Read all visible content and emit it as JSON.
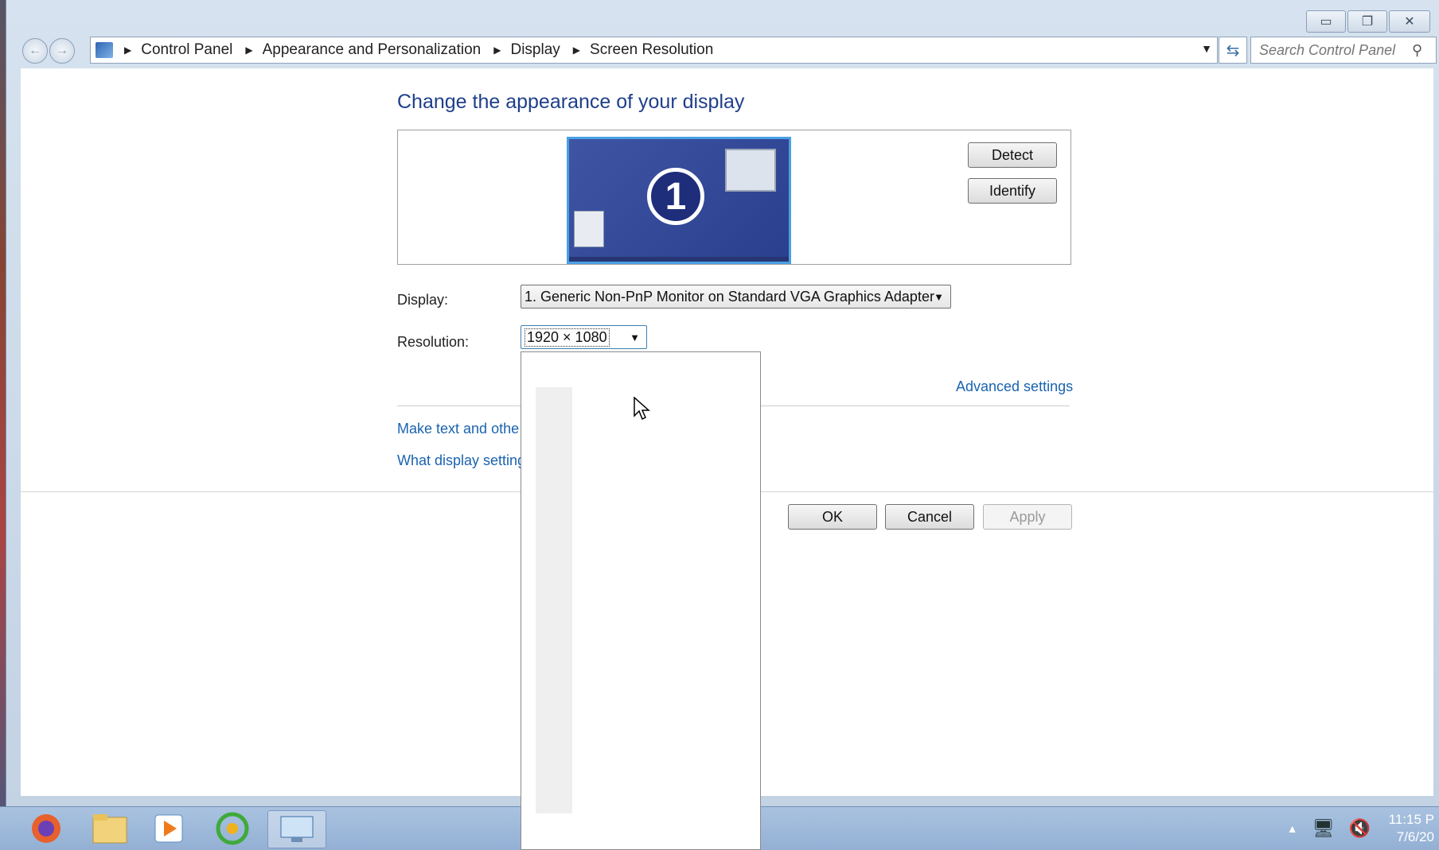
{
  "window": {
    "minimize_glyph": "▭",
    "maximize_glyph": "❐",
    "close_glyph": "✕"
  },
  "nav": {
    "back_glyph": "←",
    "forward_glyph": "→",
    "breadcrumb": [
      "Control Panel",
      "Appearance and Personalization",
      "Display",
      "Screen Resolution"
    ],
    "search_placeholder": "Search Control Panel"
  },
  "main": {
    "title": "Change the appearance of your display",
    "monitor_number": "1",
    "detect_label": "Detect",
    "identify_label": "Identify",
    "display_label": "Display:",
    "display_value": "1. Generic Non-PnP Monitor on Standard VGA Graphics Adapter",
    "resolution_label": "Resolution:",
    "resolution_value": "1920 × 1080",
    "advanced_link": "Advanced settings",
    "link_text_size": "Make text and othe",
    "link_display_settings": "What display setting"
  },
  "footer": {
    "ok_label": "OK",
    "cancel_label": "Cancel",
    "apply_label": "Apply"
  },
  "taskbar": {
    "clock_time": "11:15 P",
    "clock_date": "7/6/20"
  },
  "colors": {
    "title": "#1e3f8a",
    "link": "#1a63b0",
    "monitor_bg": "#3f55a3"
  }
}
